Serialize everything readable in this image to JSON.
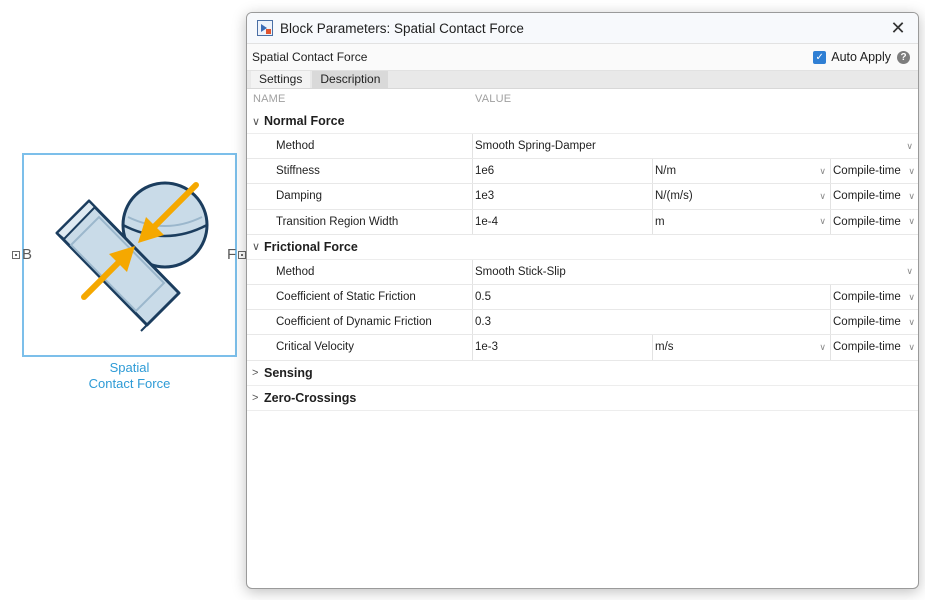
{
  "canvas": {
    "block_caption_line1": "Spatial",
    "block_caption_line2": "Contact Force",
    "port_left": "B",
    "port_right": "F"
  },
  "dialog": {
    "title": "Block Parameters: Spatial Contact Force",
    "close_glyph": "✕",
    "block_name": "Spatial Contact Force",
    "auto_apply_label": "Auto Apply",
    "auto_apply_checked": true,
    "help_glyph": "?",
    "tabs": [
      "Settings",
      "Description"
    ],
    "col_name": "NAME",
    "col_value": "VALUE"
  },
  "sections": {
    "normal": {
      "label": "Normal Force",
      "method": {
        "name": "Method",
        "value": "Smooth Spring-Damper"
      },
      "stiffness": {
        "name": "Stiffness",
        "value": "1e6",
        "unit": "N/m",
        "config": "Compile-time"
      },
      "damping": {
        "name": "Damping",
        "value": "1e3",
        "unit": "N/(m/s)",
        "config": "Compile-time"
      },
      "transition": {
        "name": "Transition Region Width",
        "value": "1e-4",
        "unit": "m",
        "config": "Compile-time"
      }
    },
    "frictional": {
      "label": "Frictional Force",
      "method": {
        "name": "Method",
        "value": "Smooth Stick-Slip"
      },
      "static": {
        "name": "Coefficient of Static Friction",
        "value": "0.5",
        "config": "Compile-time"
      },
      "dynamic": {
        "name": "Coefficient of Dynamic Friction",
        "value": "0.3",
        "config": "Compile-time"
      },
      "velocity": {
        "name": "Critical Velocity",
        "value": "1e-3",
        "unit": "m/s",
        "config": "Compile-time"
      }
    },
    "sensing": {
      "label": "Sensing"
    },
    "zero": {
      "label": "Zero-Crossings"
    }
  },
  "icons": {
    "chevron_down": "∨",
    "chevron_right": ">",
    "dropdown": "∨"
  },
  "colors": {
    "block_border": "#7cbfea",
    "caption": "#2e9bd6",
    "arrow": "#f5a800",
    "shape_outline": "#1b3d5e",
    "shape_fill": "#c9dbe8",
    "checkbox": "#2f7fd4"
  }
}
